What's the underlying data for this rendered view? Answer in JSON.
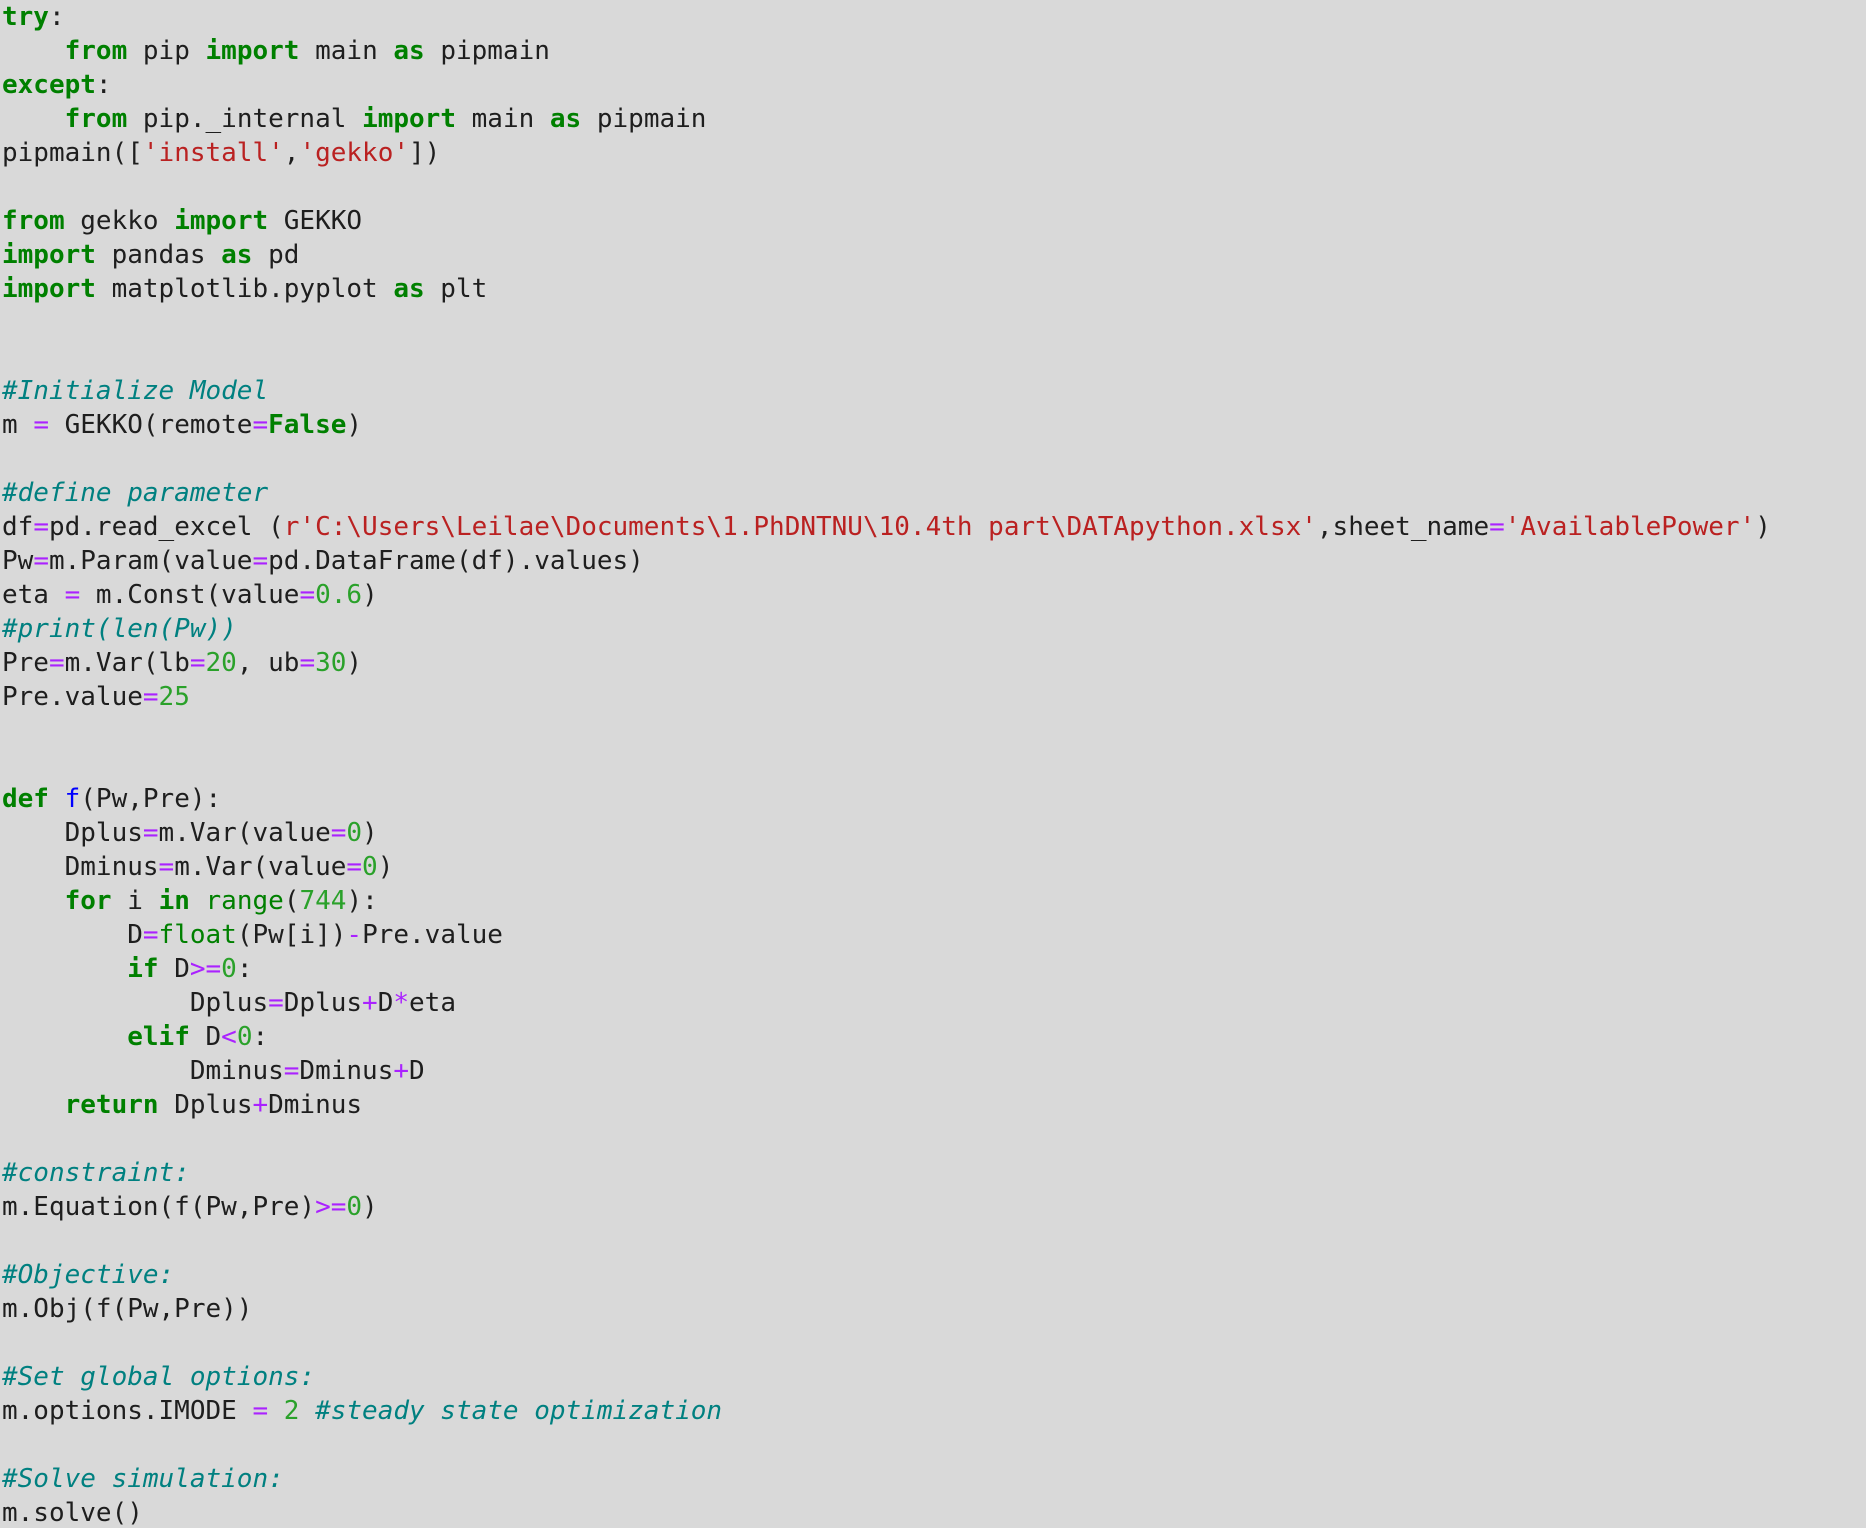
{
  "code_lines": [
    [
      [
        "kw",
        "try"
      ],
      [
        "p",
        ":"
      ]
    ],
    [
      [
        "p",
        "    "
      ],
      [
        "kw",
        "from"
      ],
      [
        "p",
        " pip "
      ],
      [
        "kw",
        "import"
      ],
      [
        "p",
        " main "
      ],
      [
        "kw",
        "as"
      ],
      [
        "p",
        " pipmain"
      ]
    ],
    [
      [
        "kw",
        "except"
      ],
      [
        "p",
        ":"
      ]
    ],
    [
      [
        "p",
        "    "
      ],
      [
        "kw",
        "from"
      ],
      [
        "p",
        " pip._internal "
      ],
      [
        "kw",
        "import"
      ],
      [
        "p",
        " main "
      ],
      [
        "kw",
        "as"
      ],
      [
        "p",
        " pipmain"
      ]
    ],
    [
      [
        "p",
        "pipmain(["
      ],
      [
        "st",
        "'install'"
      ],
      [
        "p",
        ","
      ],
      [
        "st",
        "'gekko'"
      ],
      [
        "p",
        "])"
      ]
    ],
    [],
    [
      [
        "kw",
        "from"
      ],
      [
        "p",
        " gekko "
      ],
      [
        "kw",
        "import"
      ],
      [
        "p",
        " GEKKO"
      ]
    ],
    [
      [
        "kw",
        "import"
      ],
      [
        "p",
        " pandas "
      ],
      [
        "kw",
        "as"
      ],
      [
        "p",
        " pd"
      ]
    ],
    [
      [
        "kw",
        "import"
      ],
      [
        "p",
        " matplotlib.pyplot "
      ],
      [
        "kw",
        "as"
      ],
      [
        "p",
        " plt"
      ]
    ],
    [],
    [],
    [
      [
        "cm",
        "#Initialize Model"
      ]
    ],
    [
      [
        "p",
        "m "
      ],
      [
        "op",
        "="
      ],
      [
        "p",
        " GEKKO(remote"
      ],
      [
        "op",
        "="
      ],
      [
        "kw",
        "False"
      ],
      [
        "p",
        ")"
      ]
    ],
    [],
    [
      [
        "cm",
        "#define parameter"
      ]
    ],
    [
      [
        "p",
        "df"
      ],
      [
        "op",
        "="
      ],
      [
        "p",
        "pd.read_excel ("
      ],
      [
        "st",
        "r'C:\\Users\\Leilae\\Documents\\1.PhDNTNU\\10.4th part\\DATApython.xlsx'"
      ],
      [
        "p",
        ",sheet_name"
      ],
      [
        "op",
        "="
      ],
      [
        "st",
        "'AvailablePower'"
      ],
      [
        "p",
        ")"
      ]
    ],
    [
      [
        "p",
        "Pw"
      ],
      [
        "op",
        "="
      ],
      [
        "p",
        "m.Param(value"
      ],
      [
        "op",
        "="
      ],
      [
        "p",
        "pd.DataFrame(df).values)"
      ]
    ],
    [
      [
        "p",
        "eta "
      ],
      [
        "op",
        "="
      ],
      [
        "p",
        " m.Const(value"
      ],
      [
        "op",
        "="
      ],
      [
        "nm",
        "0.6"
      ],
      [
        "p",
        ")"
      ]
    ],
    [
      [
        "cm",
        "#print(len(Pw))"
      ]
    ],
    [
      [
        "p",
        "Pre"
      ],
      [
        "op",
        "="
      ],
      [
        "p",
        "m.Var(lb"
      ],
      [
        "op",
        "="
      ],
      [
        "nm",
        "20"
      ],
      [
        "p",
        ", ub"
      ],
      [
        "op",
        "="
      ],
      [
        "nm",
        "30"
      ],
      [
        "p",
        ")"
      ]
    ],
    [
      [
        "p",
        "Pre.value"
      ],
      [
        "op",
        "="
      ],
      [
        "nm",
        "25"
      ]
    ],
    [],
    [],
    [
      [
        "kw",
        "def"
      ],
      [
        "p",
        " "
      ],
      [
        "fn",
        "f"
      ],
      [
        "p",
        "(Pw,Pre):"
      ]
    ],
    [
      [
        "p",
        "    Dplus"
      ],
      [
        "op",
        "="
      ],
      [
        "p",
        "m.Var(value"
      ],
      [
        "op",
        "="
      ],
      [
        "nm",
        "0"
      ],
      [
        "p",
        ")"
      ]
    ],
    [
      [
        "p",
        "    Dminus"
      ],
      [
        "op",
        "="
      ],
      [
        "p",
        "m.Var(value"
      ],
      [
        "op",
        "="
      ],
      [
        "nm",
        "0"
      ],
      [
        "p",
        ")"
      ]
    ],
    [
      [
        "p",
        "    "
      ],
      [
        "kw",
        "for"
      ],
      [
        "p",
        " i "
      ],
      [
        "kw",
        "in"
      ],
      [
        "p",
        " "
      ],
      [
        "bi",
        "range"
      ],
      [
        "p",
        "("
      ],
      [
        "nm",
        "744"
      ],
      [
        "p",
        "):"
      ]
    ],
    [
      [
        "p",
        "        D"
      ],
      [
        "op",
        "="
      ],
      [
        "bi",
        "float"
      ],
      [
        "p",
        "(Pw[i])"
      ],
      [
        "op",
        "-"
      ],
      [
        "p",
        "Pre.value"
      ]
    ],
    [
      [
        "p",
        "        "
      ],
      [
        "kw",
        "if"
      ],
      [
        "p",
        " D"
      ],
      [
        "op",
        ">="
      ],
      [
        "nm",
        "0"
      ],
      [
        "p",
        ":"
      ]
    ],
    [
      [
        "p",
        "            Dplus"
      ],
      [
        "op",
        "="
      ],
      [
        "p",
        "Dplus"
      ],
      [
        "op",
        "+"
      ],
      [
        "p",
        "D"
      ],
      [
        "op",
        "*"
      ],
      [
        "p",
        "eta"
      ]
    ],
    [
      [
        "p",
        "        "
      ],
      [
        "kw",
        "elif"
      ],
      [
        "p",
        " D"
      ],
      [
        "op",
        "<"
      ],
      [
        "nm",
        "0"
      ],
      [
        "p",
        ":"
      ]
    ],
    [
      [
        "p",
        "            Dminus"
      ],
      [
        "op",
        "="
      ],
      [
        "p",
        "Dminus"
      ],
      [
        "op",
        "+"
      ],
      [
        "p",
        "D"
      ]
    ],
    [
      [
        "p",
        "    "
      ],
      [
        "kw",
        "return"
      ],
      [
        "p",
        " Dplus"
      ],
      [
        "op",
        "+"
      ],
      [
        "p",
        "Dminus"
      ]
    ],
    [],
    [
      [
        "cm",
        "#constraint:"
      ]
    ],
    [
      [
        "p",
        "m.Equation(f(Pw,Pre)"
      ],
      [
        "op",
        ">="
      ],
      [
        "nm",
        "0"
      ],
      [
        "p",
        ")"
      ]
    ],
    [],
    [
      [
        "cm",
        "#Objective:"
      ]
    ],
    [
      [
        "p",
        "m.Obj(f(Pw,Pre))"
      ]
    ],
    [],
    [
      [
        "cm",
        "#Set global options:"
      ]
    ],
    [
      [
        "p",
        "m.options.IMODE "
      ],
      [
        "op",
        "="
      ],
      [
        "p",
        " "
      ],
      [
        "nm",
        "2"
      ],
      [
        "p",
        " "
      ],
      [
        "cm",
        "#steady state optimization"
      ]
    ],
    [],
    [
      [
        "cm",
        "#Solve simulation:"
      ]
    ],
    [
      [
        "p",
        "m.solve()"
      ]
    ]
  ]
}
